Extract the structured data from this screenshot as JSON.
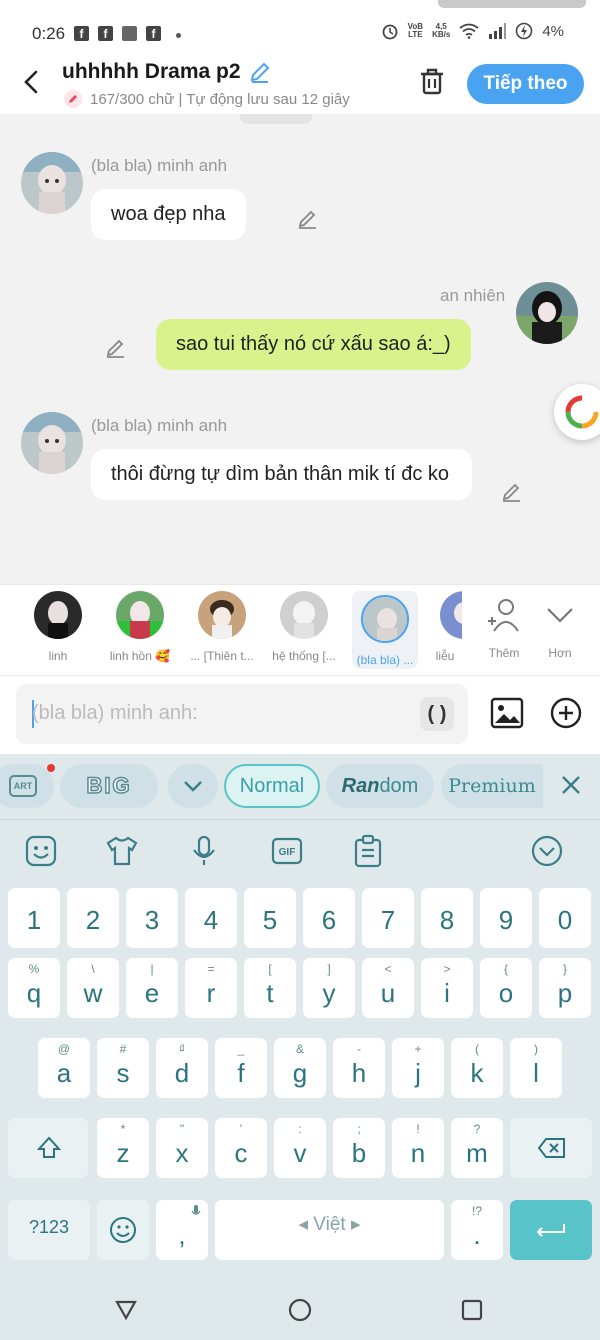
{
  "status": {
    "time": "0:26",
    "fb_glyph": "f",
    "volte_line1": "VoB",
    "volte_line2": "LTE",
    "speed_line1": "4,5",
    "speed_line2": "KB/s",
    "battery": "4%",
    "icons": [
      "alarm-icon",
      "wifi-icon",
      "signal-icon",
      "battery-charging-icon"
    ]
  },
  "header": {
    "title": "uhhhhh Drama p2",
    "subtitle": "167/300 chữ | Tự động lưu sau 12 giây",
    "next_label": "Tiếp theo"
  },
  "messages": [
    {
      "author": "(bla bla) minh anh",
      "text": "woa đẹp nha",
      "side": "left"
    },
    {
      "author": "an nhiên",
      "text": "sao tui thấy nó cứ xấu sao á:_)",
      "side": "right"
    },
    {
      "author": "(bla bla) minh anh",
      "text": "thôi đừng tự dìm bản thân mik tí đc ko",
      "side": "left"
    }
  ],
  "characters": [
    {
      "label": "linh",
      "active": false
    },
    {
      "label": "linh hồn 🥰",
      "active": false
    },
    {
      "label": "... [Thiên t...",
      "active": false
    },
    {
      "label": "hệ thống [...",
      "active": false
    },
    {
      "label": "(bla bla) ...",
      "active": true
    },
    {
      "label": "liễu",
      "active": false
    }
  ],
  "strip_actions": {
    "add_label": "Thêm",
    "more_label": "Hơn"
  },
  "composer": {
    "placeholder": "(bla bla) minh anh:",
    "paren_label": "( )"
  },
  "keyboard": {
    "chips": {
      "art": "ART",
      "big": "BIG",
      "normal": "Normal",
      "random_bold": "Ran",
      "random_rest": "dom",
      "premium": "Premium"
    },
    "number_row": [
      "1",
      "2",
      "3",
      "4",
      "5",
      "6",
      "7",
      "8",
      "9",
      "0"
    ],
    "row1": [
      {
        "k": "q",
        "h": "%"
      },
      {
        "k": "w",
        "h": "\\"
      },
      {
        "k": "e",
        "h": "|"
      },
      {
        "k": "r",
        "h": "="
      },
      {
        "k": "t",
        "h": "["
      },
      {
        "k": "y",
        "h": "]"
      },
      {
        "k": "u",
        "h": "<"
      },
      {
        "k": "i",
        "h": ">"
      },
      {
        "k": "o",
        "h": "{"
      },
      {
        "k": "p",
        "h": "}"
      }
    ],
    "row2": [
      {
        "k": "a",
        "h": "@"
      },
      {
        "k": "s",
        "h": "#"
      },
      {
        "k": "d",
        "h": "₫"
      },
      {
        "k": "f",
        "h": "_"
      },
      {
        "k": "g",
        "h": "&"
      },
      {
        "k": "h",
        "h": "-"
      },
      {
        "k": "j",
        "h": "+"
      },
      {
        "k": "k",
        "h": "("
      },
      {
        "k": "l",
        "h": ")"
      }
    ],
    "row3": [
      {
        "k": "z",
        "h": "*"
      },
      {
        "k": "x",
        "h": "\""
      },
      {
        "k": "c",
        "h": "'"
      },
      {
        "k": "v",
        "h": ":"
      },
      {
        "k": "b",
        "h": ";"
      },
      {
        "k": "n",
        "h": "!"
      },
      {
        "k": "m",
        "h": "?"
      }
    ],
    "sym_label": "?123",
    "comma": ",",
    "space_label": "Việt",
    "period": ".",
    "period_hint": "!?"
  },
  "colors": {
    "accent": "#4aa3f0",
    "bubble_me": "#d9f28c",
    "kb_bg": "#dfe9ec",
    "kb_text": "#2c7580",
    "enter": "#58c3c9"
  }
}
